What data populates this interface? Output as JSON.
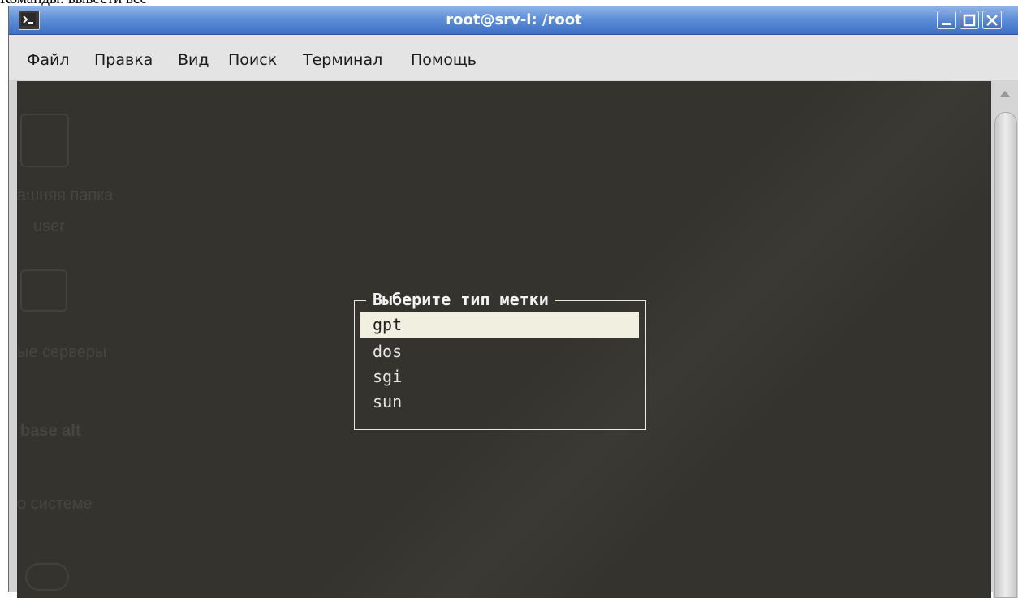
{
  "doc_caption": "Команды: вывести все",
  "window": {
    "title": "root@srv-l: /root"
  },
  "menu": [
    "Файл",
    "Правка",
    "Вид",
    "Поиск",
    "Терминал",
    "Помощь"
  ],
  "dialog": {
    "title": "Выберите тип метки",
    "options": [
      "gpt",
      "dos",
      "sgi",
      "sun"
    ],
    "selected_index": 0
  },
  "desktop_ghost": {
    "labels": [
      "ашняя папка",
      "user",
      "ые серверы",
      "base alt",
      "о системе"
    ]
  },
  "colors": {
    "terminal_bg": "#34332e",
    "titlebar": "#5e8fd8",
    "selection_bg": "#f1efdf"
  }
}
